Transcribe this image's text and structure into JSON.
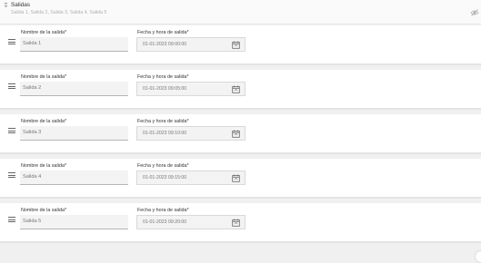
{
  "header": {
    "title": "Salidas",
    "summary": "Salida 1, Salida 2, Salida 3, Salida 4, Salida 5"
  },
  "labels": {
    "name": "Nombre de la salida*",
    "datetime": "Fecha y hora de salida*"
  },
  "rows": [
    {
      "name": "Salida 1",
      "datetime": "01-01-2023 09:00:00"
    },
    {
      "name": "Salida 2",
      "datetime": "01-01-2023 09:05:00"
    },
    {
      "name": "Salida 3",
      "datetime": "01-01-2023 09:10:00"
    },
    {
      "name": "Salida 4",
      "datetime": "01-01-2023 09:15:00"
    },
    {
      "name": "Salida 5",
      "datetime": "01-01-2023 09:20:00"
    }
  ],
  "icons": {
    "collapse": "chevron-collapse-icon",
    "visibility": "eye-off-icon",
    "drag": "drag-handle-icon",
    "calendar": "calendar-icon"
  }
}
